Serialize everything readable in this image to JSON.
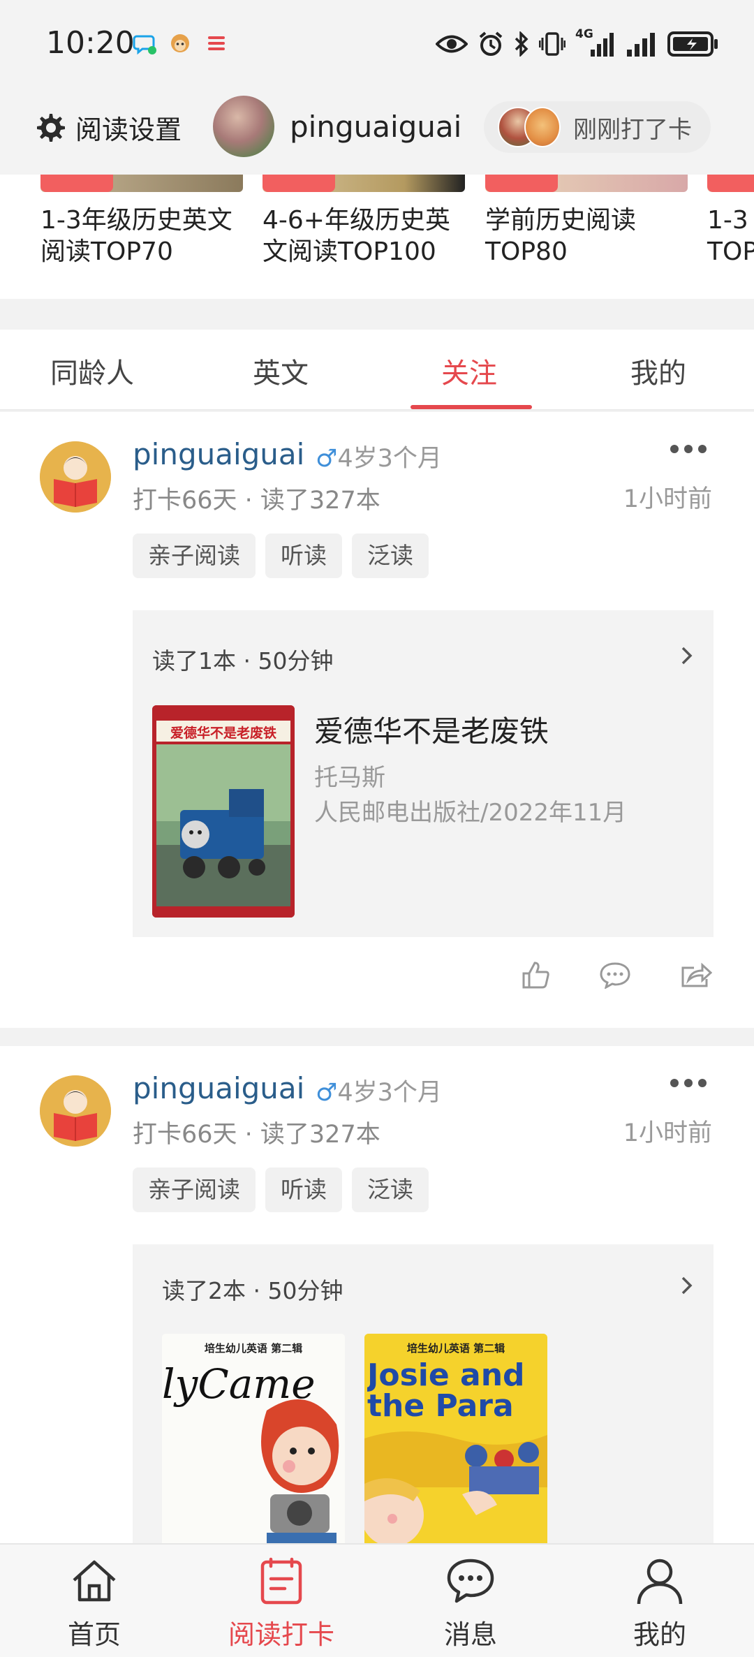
{
  "status_bar": {
    "time": "10:20",
    "network": "4G"
  },
  "top_nav": {
    "settings_label": "阅读设置",
    "profile_name": "pinguaiguai",
    "checkin_label": "刚刚打了卡"
  },
  "lists": [
    {
      "title": "1-3年级历史英文\n阅读TOP70"
    },
    {
      "title": "4-6+年级历史英\n文阅读TOP100"
    },
    {
      "title": "学前历史阅读\nTOP80"
    },
    {
      "title": "1-3\nTOP"
    }
  ],
  "tabs": [
    {
      "label": "同龄人"
    },
    {
      "label": "英文"
    },
    {
      "label": "关注"
    },
    {
      "label": "我的"
    }
  ],
  "active_tab": "关注",
  "posts": [
    {
      "username": "pinguaiguai",
      "gender_symbol": "♂",
      "age": "4岁3个月",
      "stats": "打卡66天 · 读了327本",
      "time": "1小时前",
      "tags": [
        "亲子阅读",
        "听读",
        "泛读"
      ],
      "reading_summary": "读了1本 · 50分钟",
      "book": {
        "title": "爱德华不是老废铁",
        "cover_text": "爱德华不是老废铁",
        "author": "托马斯",
        "publisher": "人民邮电出版社/2022年11月"
      }
    },
    {
      "username": "pinguaiguai",
      "gender_symbol": "♂",
      "age": "4岁3个月",
      "stats": "打卡66天 · 读了327本",
      "time": "1小时前",
      "tags": [
        "亲子阅读",
        "听读",
        "泛读"
      ],
      "reading_summary": "读了2本 · 50分钟",
      "covers": [
        {
          "series": "培生幼儿英语 第二辑",
          "title": "lyCame"
        },
        {
          "series": "培生幼儿英语 第二辑",
          "title": "Josie and the Para"
        }
      ]
    }
  ],
  "bottom_nav": [
    {
      "label": "首页",
      "icon": "home-icon"
    },
    {
      "label": "阅读打卡",
      "icon": "reading-checkin-icon"
    },
    {
      "label": "消息",
      "icon": "message-icon"
    },
    {
      "label": "我的",
      "icon": "profile-icon"
    }
  ],
  "colors": {
    "accent": "#e5484d",
    "username": "#2a5d8a",
    "gender": "#3f8fd9"
  }
}
